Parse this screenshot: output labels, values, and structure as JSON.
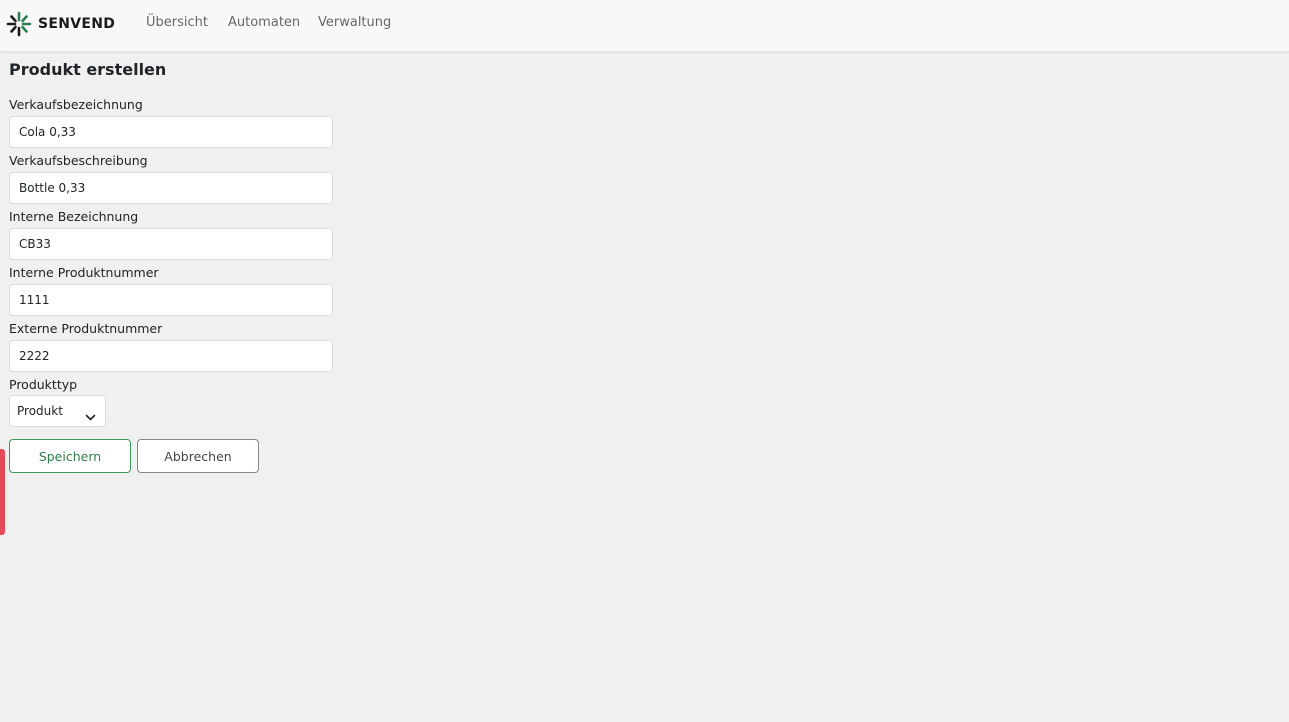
{
  "brand": {
    "name": "SENVEND",
    "logo_icon": "senvend-star-logo",
    "accent_color": "#2e7d4f"
  },
  "nav": {
    "items": [
      {
        "label": "Übersicht"
      },
      {
        "label": "Automaten"
      },
      {
        "label": "Verwaltung"
      }
    ]
  },
  "page": {
    "title": "Produkt erstellen"
  },
  "form": {
    "fields": [
      {
        "label": "Verkaufsbezeichnung",
        "value": "Cola 0,33"
      },
      {
        "label": "Verkaufsbeschreibung",
        "value": "Bottle 0,33"
      },
      {
        "label": "Interne Bezeichnung",
        "value": "CB33"
      },
      {
        "label": "Interne Produktnummer",
        "value": "1111"
      },
      {
        "label": "Externe Produktnummer",
        "value": "2222"
      }
    ],
    "product_type": {
      "label": "Produkttyp",
      "selected": "Produkt",
      "icon": "chevron-down-icon"
    },
    "buttons": {
      "save_label": "Speichern",
      "cancel_label": "Abbrechen"
    }
  },
  "colors": {
    "save_border": "#3a9a5b",
    "side_tab": "#e34a55",
    "page_background": "#f0f0f0"
  }
}
